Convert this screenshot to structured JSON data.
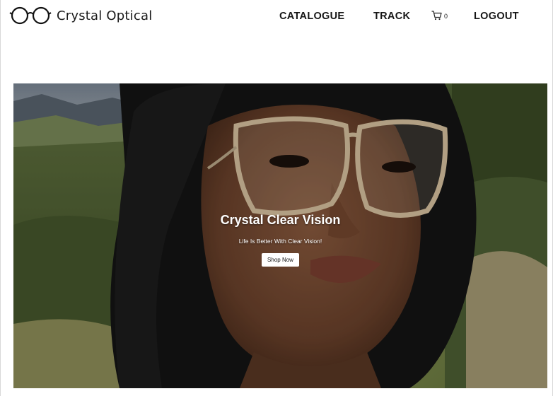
{
  "header": {
    "brand_name": "Crystal Optical",
    "brand_icon": "glasses-icon",
    "nav": {
      "catalogue": "CATALOGUE",
      "track": "TRACK",
      "logout": "LOGOUT"
    },
    "cart": {
      "icon": "cart-icon",
      "count": "0"
    }
  },
  "hero": {
    "title": "Crystal Clear Vision",
    "subtitle": "Life Is Better With Clear Vision!",
    "button_label": "Shop Now",
    "image": "portrait-photo"
  },
  "colors": {
    "text": "#161616",
    "background": "#ffffff",
    "button_bg": "#ffffff"
  }
}
